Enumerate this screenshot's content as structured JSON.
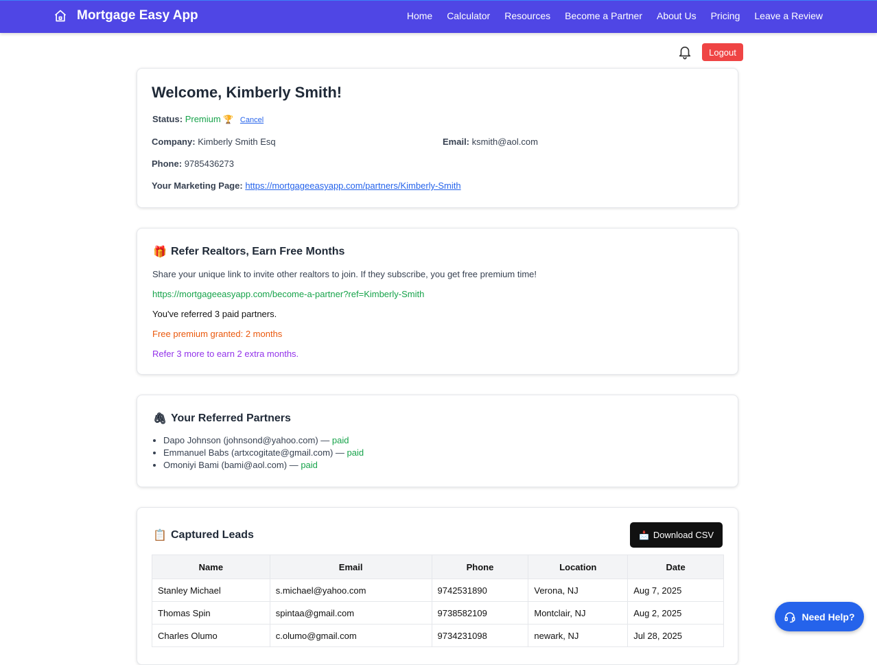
{
  "app": {
    "title": "Mortgage Easy App",
    "icon": "home-icon"
  },
  "nav": [
    "Home",
    "Calculator",
    "Resources",
    "Become a Partner",
    "About Us",
    "Pricing",
    "Leave a Review"
  ],
  "utility": {
    "logout_label": "Logout",
    "bell_icon": "bell-icon"
  },
  "profile": {
    "welcome": "Welcome, Kimberly Smith!",
    "status_label": "Status:",
    "status_value": "Premium",
    "status_emoji": "🏆",
    "cancel_label": "Cancel",
    "company_label": "Company:",
    "company_value": "Kimberly Smith Esq",
    "email_label": "Email:",
    "email_value": "ksmith@aol.com",
    "phone_label": "Phone:",
    "phone_value": "9785436273",
    "marketing_label": "Your Marketing Page:",
    "marketing_url": "https://mortgageeasyapp.com/partners/Kimberly-Smith"
  },
  "referral": {
    "emoji": "🎁",
    "title": "Refer Realtors, Earn Free Months",
    "description": "Share your unique link to invite other realtors to join. If they subscribe, you get free premium time!",
    "link": "https://mortgageeasyapp.com/become-a-partner?ref=Kimberly-Smith",
    "referred_text": "You've referred 3 paid partners.",
    "granted_text": "Free premium granted: 2 months",
    "next_text": "Refer 3 more to earn 2 extra months."
  },
  "partners": {
    "emoji": "🖇",
    "title": "Your Referred Partners",
    "items": [
      {
        "name": "Dapo Johnson (johnsond@yahoo.com) —",
        "status": "paid"
      },
      {
        "name": "Emmanuel Babs (artxcogitate@gmail.com) —",
        "status": "paid"
      },
      {
        "name": "Omoniyi Bami (bami@aol.com) —",
        "status": "paid"
      }
    ]
  },
  "leads": {
    "emoji": "📋",
    "title": "Captured Leads",
    "download_label": "Download CSV",
    "download_emoji": "📩",
    "columns": [
      "Name",
      "Email",
      "Phone",
      "Location",
      "Date"
    ],
    "rows": [
      [
        "Stanley Michael",
        "s.michael@yahoo.com",
        "9742531890",
        "Verona, NJ",
        "Aug 7, 2025"
      ],
      [
        "Thomas Spin",
        "spintaa@gmail.com",
        "9738582109",
        "Montclair, NJ",
        "Aug 2, 2025"
      ],
      [
        "Charles Olumo",
        "c.olumo@gmail.com",
        "9734231098",
        "newark, NJ",
        "Jul 28, 2025"
      ]
    ]
  },
  "help": {
    "label": "Need Help?",
    "icon": "headset-icon"
  },
  "colors": {
    "nav": "#4f46e5",
    "logout": "#ef4444",
    "green": "#16a34a",
    "orange": "#ea580c",
    "purple": "#9333ea",
    "help": "#2563eb"
  }
}
